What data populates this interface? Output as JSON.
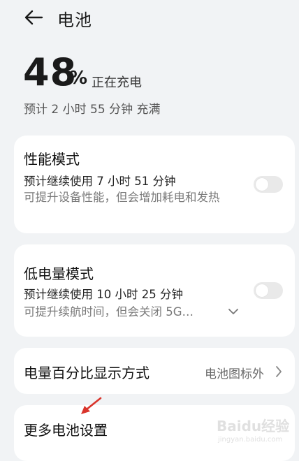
{
  "header": {
    "title": "电池"
  },
  "battery": {
    "percent": "48",
    "percent_sign": "%",
    "status": "正在充电",
    "estimate": "预计 2 小时 55 分钟 充满"
  },
  "performance_mode": {
    "title": "性能模式",
    "subtitle": "预计继续使用 7 小时 51 分钟",
    "description": "可提升设备性能，但会增加耗电和发热",
    "enabled": false
  },
  "low_power_mode": {
    "title": "低电量模式",
    "subtitle": "预计继续使用 10 小时 25 分钟",
    "description": "可提升续航时间，但会关闭 5G…",
    "enabled": false
  },
  "percentage_display": {
    "title": "电量百分比显示方式",
    "value": "电池图标外"
  },
  "more_settings": {
    "title": "更多电池设置"
  },
  "watermark": {
    "line1": "Baidu经验",
    "line2": "jingyan.baidu.com"
  },
  "colors": {
    "background": "#f1f3f5",
    "card": "#ffffff",
    "toggle_off": "#e9e9e9",
    "annotation_arrow": "#d9342b"
  },
  "icons": [
    "back-arrow-icon",
    "chevron-down-icon",
    "chevron-right-icon",
    "annotation-arrow-icon"
  ]
}
